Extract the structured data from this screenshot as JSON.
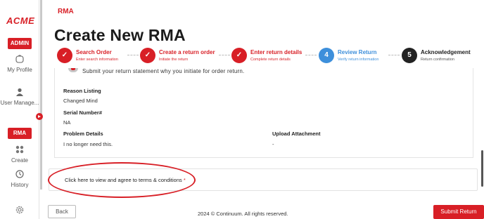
{
  "sidebar": {
    "logo": "ACME",
    "admin_badge": "ADMIN",
    "rma_badge": "RMA",
    "items": [
      {
        "label": "My Profile",
        "icon": "user-circle-icon"
      },
      {
        "label": "User Manage...",
        "icon": "users-icon"
      },
      {
        "label": "Create",
        "icon": "grid-icon"
      },
      {
        "label": "History",
        "icon": "history-icon"
      },
      {
        "label": "",
        "icon": "gear-icon"
      }
    ]
  },
  "breadcrumb": "RMA",
  "page_title": "Create New RMA",
  "steps": [
    {
      "num": "✓",
      "title": "Search Order",
      "subtitle": "Enter search information",
      "state": "done"
    },
    {
      "num": "✓",
      "title": "Create a return order",
      "subtitle": "Initiate the return",
      "state": "done"
    },
    {
      "num": "✓",
      "title": "Enter return details",
      "subtitle": "Complete return details",
      "state": "done"
    },
    {
      "num": "4",
      "title": "Review Return",
      "subtitle": "Verify return information",
      "state": "current"
    },
    {
      "num": "5",
      "title": "Acknowledgement",
      "subtitle": "Return confirmation",
      "state": "pending"
    }
  ],
  "review": {
    "subtitle": "Submit your return statement why you initiate for order return.",
    "reason_listing_label": "Reason Listing",
    "reason_listing_value": "Changed Mind",
    "serial_number_label": "Serial Number#",
    "serial_number_value": "NA",
    "problem_details_label": "Problem Details",
    "problem_details_value": "I no longer need this.",
    "upload_attachment_label": "Upload Attachment",
    "upload_attachment_value": "-"
  },
  "terms": {
    "text": "Click here to view and agree to terms & conditions",
    "required_mark": "*"
  },
  "footer": {
    "back_label": "Back",
    "copyright": "2024 © Continuum. All rights reserved.",
    "submit_label": "Submit Return"
  },
  "colors": {
    "brand_red": "#d81f26",
    "step_blue": "#3d8fdb",
    "pending": "#222222"
  }
}
